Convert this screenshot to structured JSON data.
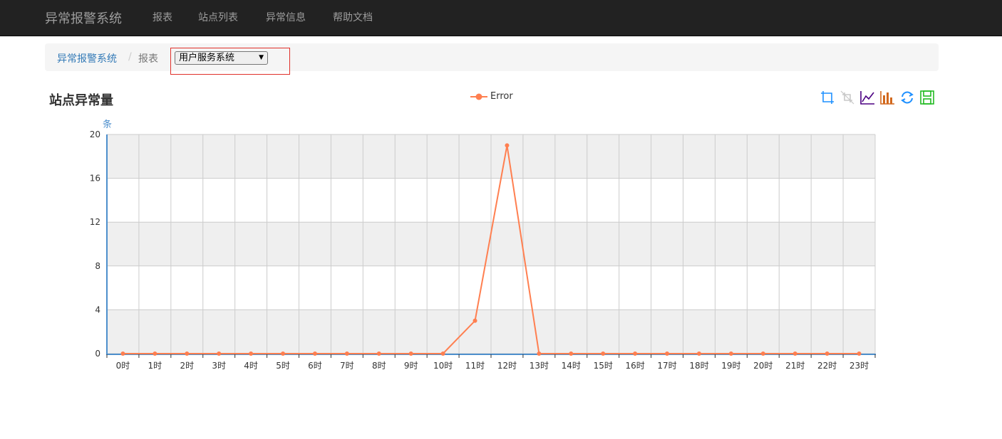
{
  "navbar": {
    "brand": "异常报警系统",
    "items": [
      "报表",
      "站点列表",
      "异常信息",
      "帮助文档"
    ]
  },
  "breadcrumb": {
    "home": "异常报警系统",
    "separator": "/",
    "current": "报表"
  },
  "site_select": {
    "selected": "用户服务系统"
  },
  "colors": {
    "series": "#ff7f50",
    "axis": "#4d8fcc",
    "grid_band": "#efefef",
    "grid_line": "#cccccc",
    "navbar": "#222222",
    "link": "#337ab7"
  },
  "toolbox": [
    "data-zoom-icon",
    "zoom-reset-icon",
    "line-chart-icon",
    "bar-chart-icon",
    "restore-icon",
    "save-image-icon"
  ],
  "chart_data": {
    "type": "line",
    "title": "站点异常量",
    "ylabel": "条",
    "ylim": [
      0,
      20
    ],
    "yticks": [
      0,
      4,
      8,
      12,
      16,
      20
    ],
    "grid": true,
    "legend_position": "top-center",
    "categories": [
      "0时",
      "1时",
      "2时",
      "3时",
      "4时",
      "5时",
      "6时",
      "7时",
      "8时",
      "9时",
      "10时",
      "11时",
      "12时",
      "13时",
      "14时",
      "15时",
      "16时",
      "17时",
      "18时",
      "19时",
      "20时",
      "21时",
      "22时",
      "23时"
    ],
    "series": [
      {
        "name": "Error",
        "values": [
          0,
          0,
          0,
          0,
          0,
          0,
          0,
          0,
          0,
          0,
          0,
          3,
          19,
          0,
          0,
          0,
          0,
          0,
          0,
          0,
          0,
          0,
          0,
          0
        ]
      }
    ]
  }
}
